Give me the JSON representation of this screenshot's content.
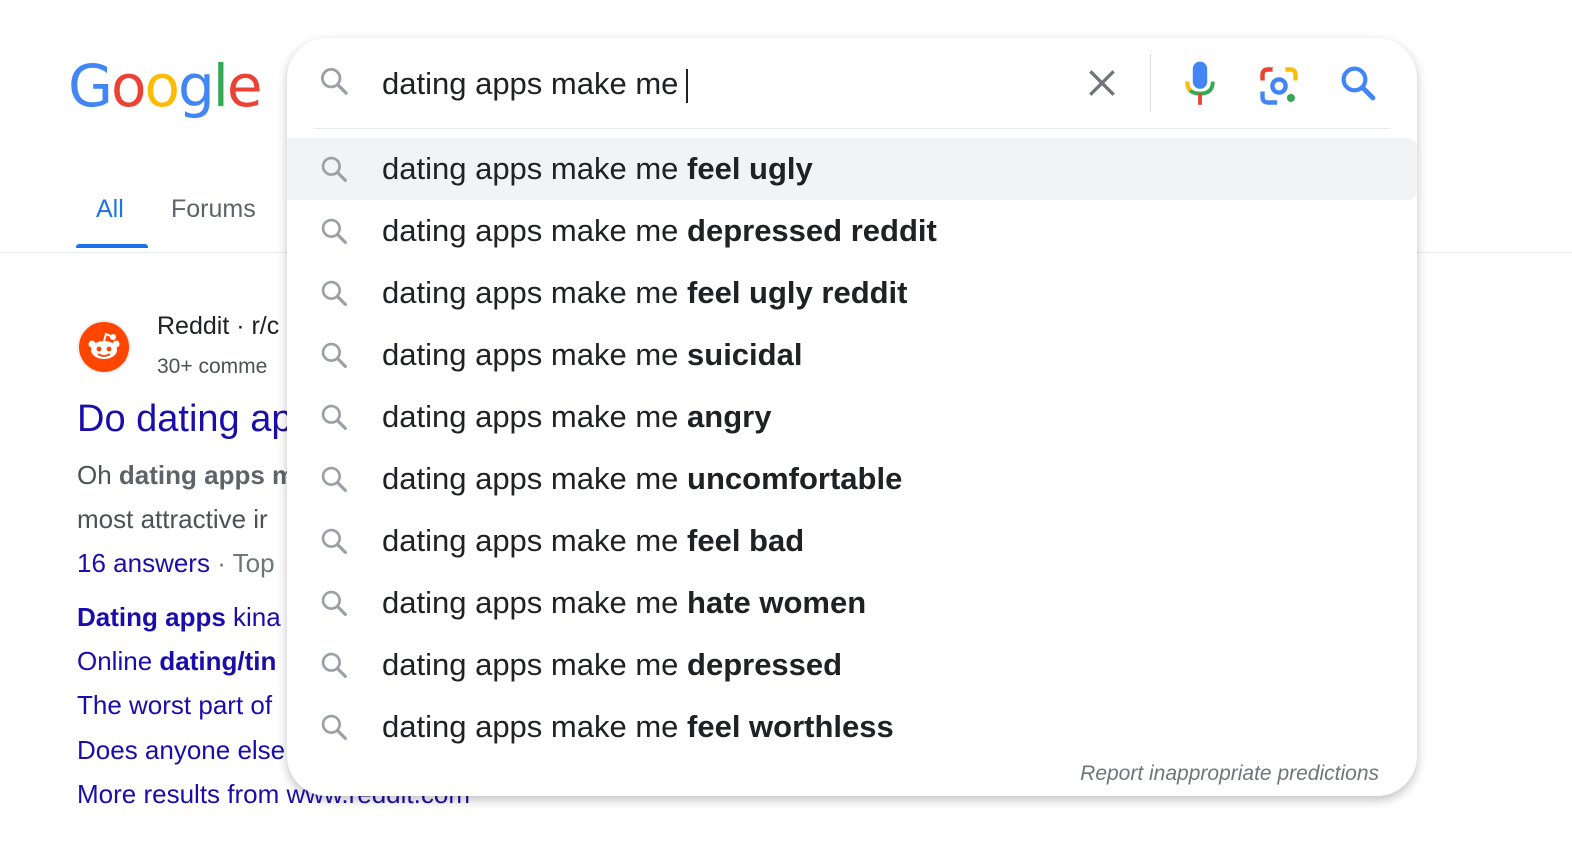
{
  "logo": {
    "letters": [
      "G",
      "o",
      "o",
      "g",
      "l",
      "e"
    ]
  },
  "tabs": {
    "all": "All",
    "forums": "Forums"
  },
  "result": {
    "site": "Reddit · r/c",
    "meta": "30+ comme",
    "title": "Do dating ap",
    "snippet1_prefix": "Oh ",
    "snippet1_bold": "dating apps m",
    "snippet2": "most attractive ir",
    "answers_link": "16 answers",
    "answers_rest": " · Top",
    "sublinks": [
      {
        "bold": "Dating apps",
        "rest": " kina"
      },
      {
        "pre": "Online ",
        "bold": "dating/tin"
      },
      {
        "text": "The worst part of"
      },
      {
        "text": "Does anyone else"
      },
      {
        "text": "More results from www.reddit.com"
      }
    ]
  },
  "search": {
    "query": "dating apps make me",
    "suggestion_prefix": "dating apps make me ",
    "suggestions": [
      "feel ugly",
      "depressed reddit",
      "feel ugly reddit",
      "suicidal",
      "angry",
      "uncomfortable",
      "feel bad",
      "hate women",
      "depressed",
      "feel worthless"
    ],
    "report_link": "Report inappropriate predictions"
  },
  "icons": {
    "search": "search-icon",
    "clear": "close-icon",
    "mic": "microphone-icon",
    "lens": "google-lens-icon",
    "favicon": "reddit-icon"
  },
  "colors": {
    "link": "#1a0dab",
    "tab_active": "#1a73e8",
    "google_blue": "#4285F4",
    "google_red": "#EA4335",
    "google_yellow": "#FBBC05",
    "google_green": "#34A853"
  }
}
